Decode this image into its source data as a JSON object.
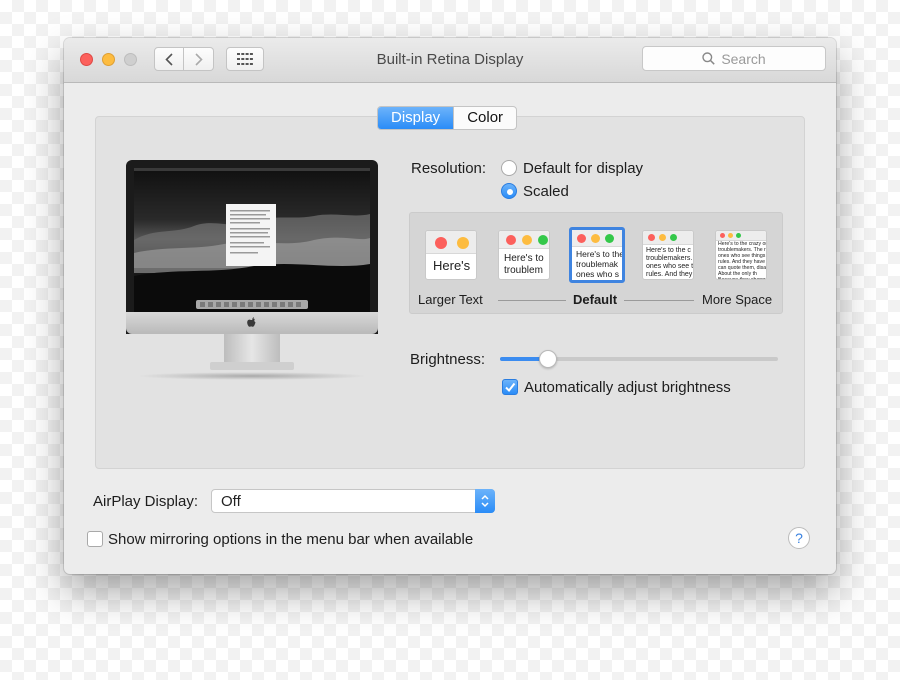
{
  "window": {
    "title": "Built-in Retina Display",
    "search_placeholder": "Search"
  },
  "tabs": [
    {
      "label": "Display",
      "active": true
    },
    {
      "label": "Color",
      "active": false
    }
  ],
  "resolution": {
    "label": "Resolution:",
    "options": [
      {
        "label": "Default for display",
        "selected": false
      },
      {
        "label": "Scaled",
        "selected": true
      }
    ],
    "scales": [
      {
        "sample": "Here's",
        "selected": false
      },
      {
        "sample": "Here's to\ntroublem",
        "selected": false
      },
      {
        "sample": "Here's to the\ntroublemak\nones who s",
        "selected": true
      },
      {
        "sample": "Here's to the c\ntroublemakers.\nones who see t\nrules. And they",
        "selected": false
      },
      {
        "sample": "Here's to the crazy ones\ntroublemakers. The rou\nones who see things di\nrules. And they have no\ncan quote them, disagr\nAbout the only th\nBecause they change th",
        "selected": false
      }
    ],
    "scale_labels": {
      "left": "Larger Text",
      "center": "Default",
      "right": "More Space"
    }
  },
  "brightness": {
    "label": "Brightness:",
    "level": 0.15,
    "auto_label": "Automatically adjust brightness",
    "auto_checked": true
  },
  "airplay": {
    "label": "AirPlay Display:",
    "value": "Off"
  },
  "mirroring": {
    "label": "Show mirroring options in the menu bar when available",
    "checked": false
  },
  "help_label": "?",
  "colors": {
    "accent": "#2a8cf7",
    "close": "#fc605c",
    "minimize": "#fdbc40",
    "zoom_disabled": "#cfcfcf"
  }
}
